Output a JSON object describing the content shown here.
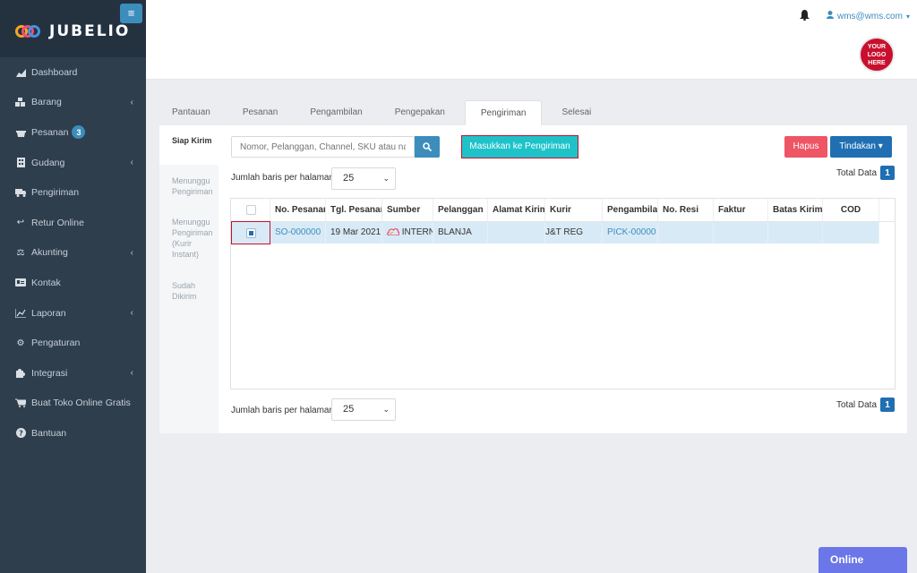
{
  "brand": {
    "name": "JUBELIO",
    "menu_icon": "hamburger-icon"
  },
  "sidebar": {
    "items": [
      {
        "label": "Dashboard",
        "icon": "chart-area-icon",
        "chevron": false
      },
      {
        "label": "Barang",
        "icon": "cubes-icon",
        "chevron": true
      },
      {
        "label": "Pesanan",
        "icon": "basket-icon",
        "chevron": false,
        "badge": "3"
      },
      {
        "label": "Gudang",
        "icon": "building-icon",
        "chevron": true
      },
      {
        "label": "Pengiriman",
        "icon": "truck-icon",
        "chevron": false
      },
      {
        "label": "Retur Online",
        "icon": "reply-icon",
        "chevron": false
      },
      {
        "label": "Akunting",
        "icon": "balance-scale-icon",
        "chevron": true
      },
      {
        "label": "Kontak",
        "icon": "id-card-icon",
        "chevron": false
      },
      {
        "label": "Laporan",
        "icon": "line-chart-icon",
        "chevron": true
      },
      {
        "label": "Pengaturan",
        "icon": "cogs-icon",
        "chevron": false
      },
      {
        "label": "Integrasi",
        "icon": "puzzle-icon",
        "chevron": true
      },
      {
        "label": "Buat Toko Online Gratis",
        "icon": "cart-icon",
        "chevron": false
      },
      {
        "label": "Bantuan",
        "icon": "question-icon",
        "chevron": false
      }
    ]
  },
  "header": {
    "user_email": "wms@wms.com",
    "logo_text": [
      "YOUR",
      "LOGO",
      "HERE"
    ]
  },
  "tabs": [
    "Pantauan",
    "Pesanan",
    "Pengambilan",
    "Pengepakan",
    "Pengiriman",
    "Selesai"
  ],
  "active_tab": "Pengiriman",
  "subtabs": [
    {
      "label": "Siap Kirim",
      "active": true
    },
    {
      "label": "Menunggu Pengiriman",
      "active": false
    },
    {
      "label": "Menunggu Pengiriman (Kurir Instant)",
      "active": false
    },
    {
      "label": "Sudah Dikirim",
      "active": false
    }
  ],
  "toolbar": {
    "search_placeholder": "Nomor, Pelanggan, Channel, SKU atau na",
    "primary_action": "Masukkan ke Pengiriman",
    "delete": "Hapus",
    "actions": "Tindakan"
  },
  "pagination": {
    "rows_label": "Jumlah baris per halaman",
    "rows_value": "25",
    "total_label": "Total Data",
    "total_value": "1"
  },
  "table": {
    "columns": [
      "No. Pesanan",
      "Tgl. Pesanan",
      "Sumber",
      "Pelanggan",
      "Alamat Kirim",
      "Kurir",
      "Pengambilan",
      "No. Resi",
      "Faktur",
      "Batas Kirim",
      "COD"
    ],
    "rows": [
      {
        "checked": true,
        "no_pesanan": "SO-000000",
        "tgl_pesanan": "19 Mar 2021",
        "sumber": "INTERNAL",
        "pelanggan": "BLANJA",
        "alamat_kirim": "",
        "kurir": "J&T REG",
        "pengambilan": "PICK-00000",
        "no_resi": "",
        "faktur": "",
        "batas_kirim": "",
        "cod": ""
      }
    ]
  },
  "chat": {
    "label": "Online"
  },
  "colors": {
    "sidebar": "#2f3e4d",
    "primary": "#3c8dbc",
    "teal": "#1ec3c9",
    "danger": "#ee5565",
    "highlight": "#c8102e"
  }
}
